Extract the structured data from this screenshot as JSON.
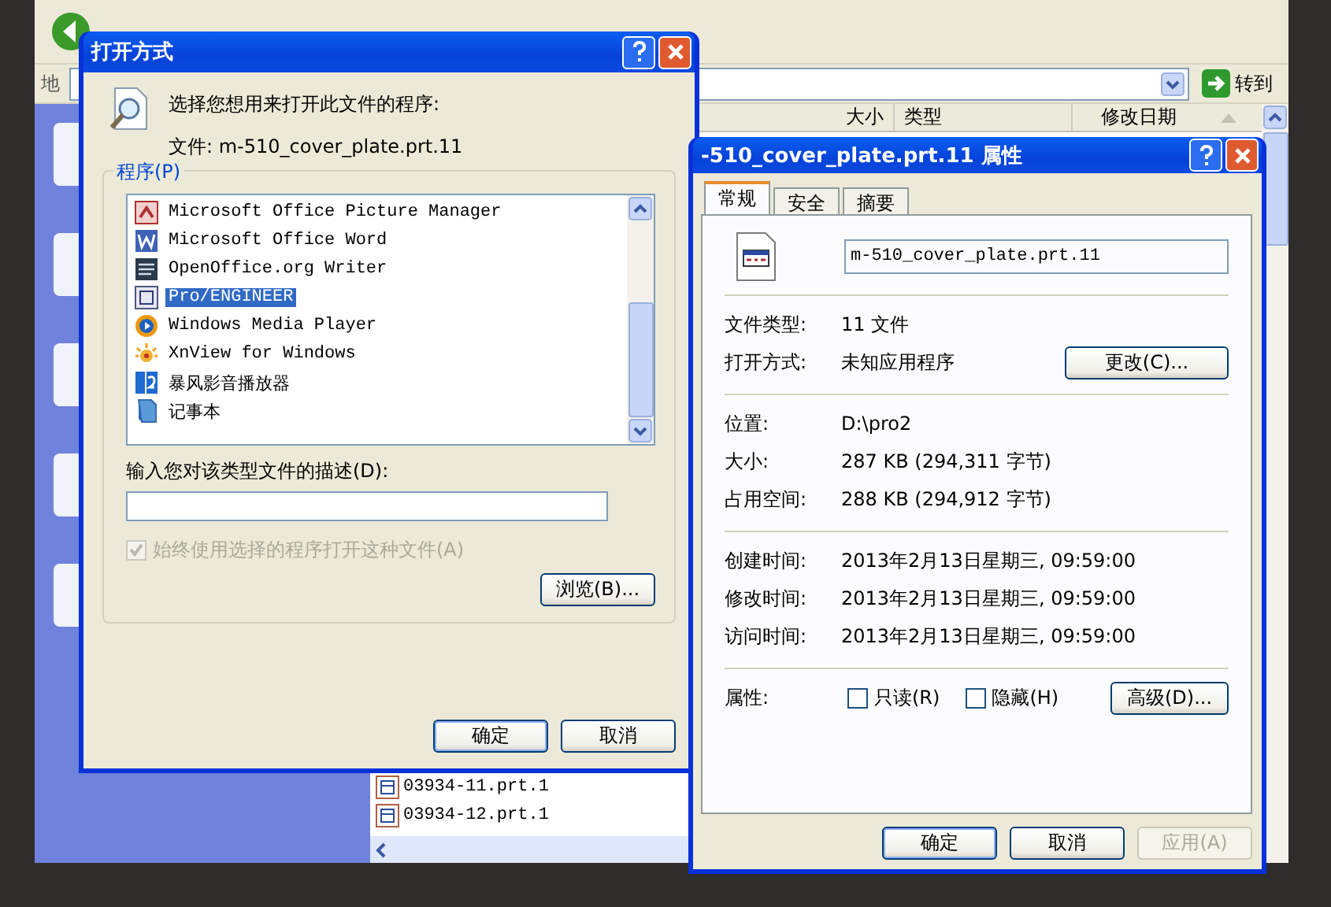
{
  "explorer": {
    "address_label": "地",
    "go_button": "转到",
    "columns": [
      "大小",
      "类型",
      "修改日期"
    ],
    "files": [
      "03934-11.prt.1",
      "03934-12.prt.1"
    ]
  },
  "open_with": {
    "title": "打开方式",
    "prompt": "选择您想用来打开此文件的程序:",
    "file_line": "文件: m-510_cover_plate.prt.11",
    "group_label": "程序(P)",
    "programs": [
      {
        "name": "Microsoft Office Picture Manager",
        "selected": false
      },
      {
        "name": "Microsoft Office Word",
        "selected": false
      },
      {
        "name": "OpenOffice.org Writer",
        "selected": false
      },
      {
        "name": "Pro/ENGINEER",
        "selected": true
      },
      {
        "name": "Windows Media Player",
        "selected": false
      },
      {
        "name": "XnView for Windows",
        "selected": false
      },
      {
        "name": "暴风影音播放器",
        "selected": false
      },
      {
        "name": "记事本",
        "selected": false
      }
    ],
    "description_label": "输入您对该类型文件的描述(D):",
    "always_use": {
      "label": "始终使用选择的程序打开这种文件(A)",
      "checked": true,
      "disabled": true
    },
    "browse_button": "浏览(B)...",
    "buttons": [
      "确定",
      "取消"
    ]
  },
  "properties": {
    "title": "-510_cover_plate.prt.11 属性",
    "tabs": [
      {
        "label": "常规",
        "selected": true
      },
      {
        "label": "安全",
        "selected": false
      },
      {
        "label": "摘要",
        "selected": false
      }
    ],
    "file_name": "m-510_cover_plate.prt.11",
    "sections": [
      [
        {
          "label": "文件类型:",
          "value": "11 文件"
        },
        {
          "label": "打开方式:",
          "value": "未知应用程序",
          "button": "更改(C)..."
        }
      ],
      [
        {
          "label": "位置:",
          "value": "D:\\pro2"
        },
        {
          "label": "大小:",
          "value": "287 KB (294,311 字节)"
        },
        {
          "label": "占用空间:",
          "value": "288 KB (294,912 字节)"
        }
      ],
      [
        {
          "label": "创建时间:",
          "value": "2013年2月13日星期三, 09:59:00"
        },
        {
          "label": "修改时间:",
          "value": "2013年2月13日星期三, 09:59:00"
        },
        {
          "label": "访问时间:",
          "value": "2013年2月13日星期三, 09:59:00"
        }
      ]
    ],
    "attributes_label": "属性:",
    "attributes": [
      {
        "label": "只读(R)",
        "checked": false
      },
      {
        "label": "隐藏(H)",
        "checked": false
      }
    ],
    "advanced_button": "高级(D)...",
    "buttons": [
      {
        "label": "确定",
        "disabled": false
      },
      {
        "label": "取消",
        "disabled": false
      },
      {
        "label": "应用(A)",
        "disabled": true
      }
    ]
  }
}
